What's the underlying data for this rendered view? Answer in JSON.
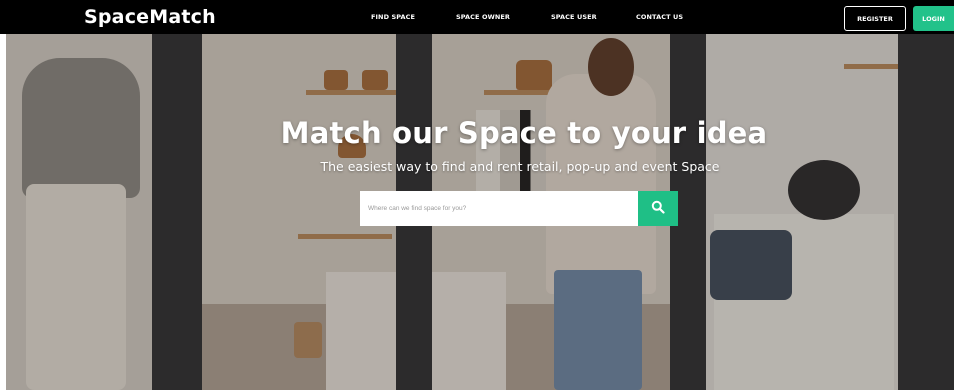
{
  "brand": {
    "name": "SpaceMatch"
  },
  "nav": {
    "links": [
      "FIND SPACE",
      "SPACE OWNER",
      "SPACE USER",
      "CONTACT US"
    ],
    "register_label": "REGISTER",
    "login_label": "LOGIN"
  },
  "hero": {
    "title": "Match our Space to your idea",
    "subtitle": "The easiest way to find and rent retail, pop-up and event Space",
    "search": {
      "placeholder": "Where can we find space for you?",
      "value": "",
      "button_icon": "search-icon"
    }
  },
  "colors": {
    "nav_background": "#000000",
    "accent_green": "#22c28a",
    "search_button": "#1fbf86"
  }
}
